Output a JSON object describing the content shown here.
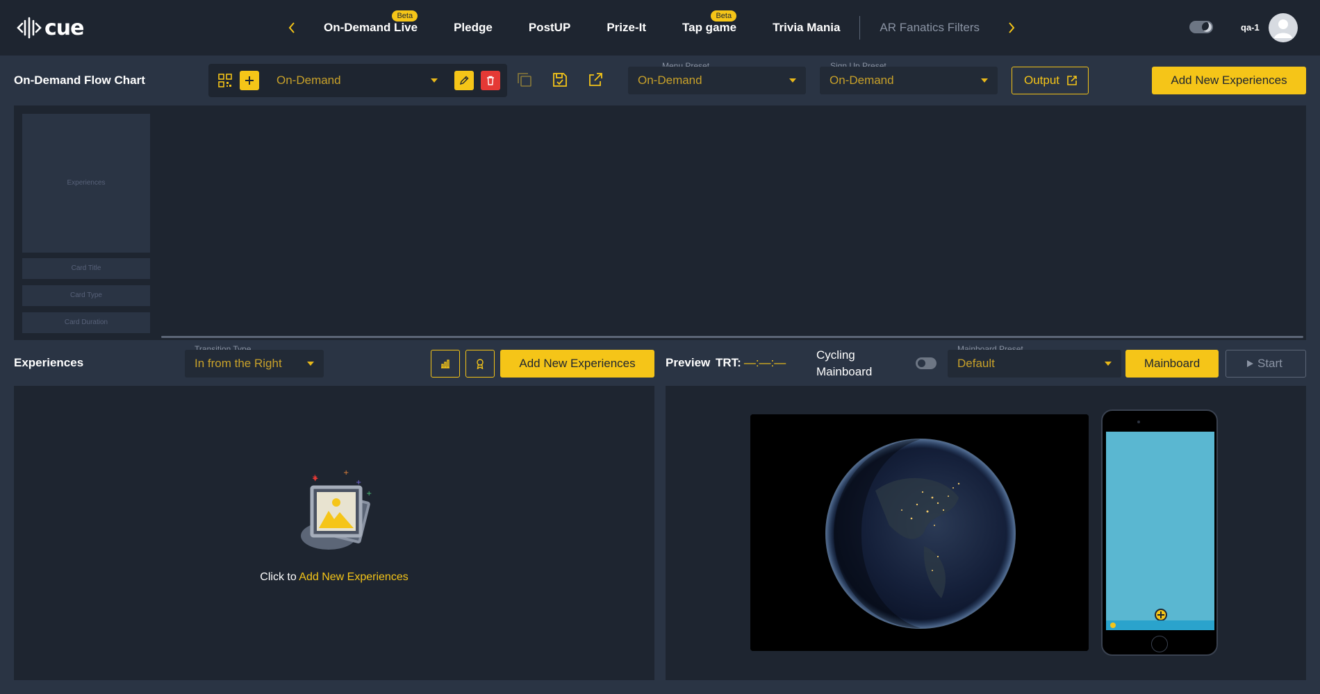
{
  "app": {
    "logo_text": "cue",
    "user": "qa-1"
  },
  "nav": {
    "items": [
      {
        "label": "On-Demand Live",
        "badge": "Beta"
      },
      {
        "label": "Pledge"
      },
      {
        "label": "PostUP"
      },
      {
        "label": "Prize-It"
      },
      {
        "label": "Tap game",
        "badge": "Beta"
      },
      {
        "label": "Trivia Mania"
      },
      {
        "label": "AR Fanatics Filters"
      }
    ]
  },
  "flow": {
    "title": "On-Demand Flow Chart",
    "selector_value": "On-Demand",
    "menu_preset_label": "Menu Preset",
    "menu_preset_value": "On-Demand",
    "signup_preset_label": "Sign Up Preset",
    "signup_preset_value": "On-Demand",
    "output_label": "Output",
    "add_button": "Add New Experiences",
    "card": {
      "experiences": "Experiences",
      "title": "Card Title",
      "type": "Card Type",
      "duration": "Card Duration"
    }
  },
  "experiences": {
    "title": "Experiences",
    "transition_label": "Transition Type",
    "transition_value": "In from the Right",
    "add_button": "Add New Experiences",
    "empty_prefix": "Click to",
    "empty_link": "Add New Experiences"
  },
  "preview": {
    "title": "Preview",
    "trt_label": "TRT:",
    "trt_value": "—:—:—",
    "cycling_line1": "Cycling",
    "cycling_line2": "Mainboard",
    "mainboard_preset_label": "Mainboard Preset",
    "mainboard_preset_value": "Default",
    "mainboard_button": "Mainboard",
    "start_button": "Start"
  },
  "colors": {
    "accent": "#f5c518",
    "danger": "#e53935",
    "background": "#2a3444",
    "panel": "#1e2530"
  }
}
